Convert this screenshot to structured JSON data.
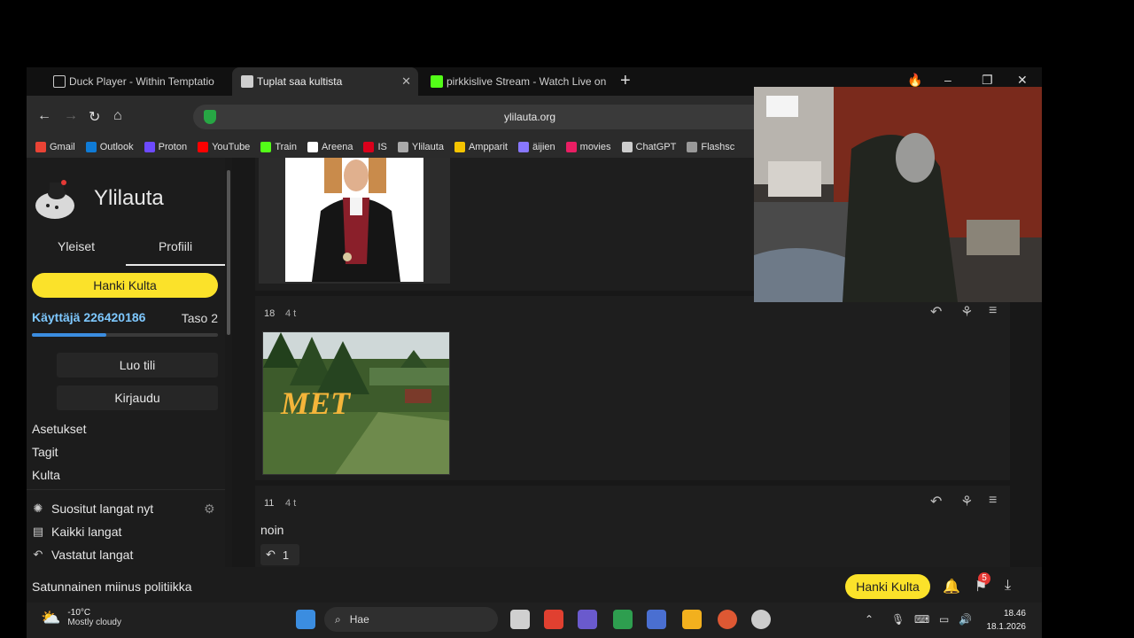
{
  "browser": {
    "tabs": [
      {
        "label": "Duck Player - Within Temptatio",
        "icon": "duck-player-icon"
      },
      {
        "label": "Tuplat saa kultista",
        "icon": "ylilauta-favicon",
        "active": true
      },
      {
        "label": "pirkkislive Stream - Watch Live on",
        "icon": "kick-favicon"
      }
    ],
    "new_tab": "+",
    "window_controls": {
      "minimize": "–",
      "restore": "❐",
      "close": "✕",
      "flame": "🔥"
    },
    "url": "ylilauta.org",
    "bookmarks": [
      {
        "label": "Gmail",
        "color": "#ea4335"
      },
      {
        "label": "Outlook",
        "color": "#0f7bd6"
      },
      {
        "label": "Proton",
        "color": "#6d4aff"
      },
      {
        "label": "YouTube",
        "color": "#ff0000"
      },
      {
        "label": "Train",
        "color": "#53fc18"
      },
      {
        "label": "Areena",
        "color": "#ffffff"
      },
      {
        "label": "IS",
        "color": "#d9001b"
      },
      {
        "label": "Ylilauta",
        "color": "#aaaaaa"
      },
      {
        "label": "Ampparit",
        "color": "#f5c400"
      },
      {
        "label": "äijien",
        "color": "#8877ff"
      },
      {
        "label": "movies",
        "color": "#e91e63"
      },
      {
        "label": "ChatGPT",
        "color": "#cccccc"
      },
      {
        "label": "Flashsc",
        "color": "#999999"
      }
    ]
  },
  "sidebar": {
    "brand": "Ylilauta",
    "tabs": [
      "Yleiset",
      "Profiili"
    ],
    "gold_button": "Hanki Kulta",
    "user": "Käyttäjä 226420186",
    "level": "Taso 2",
    "xp_fraction": 0.4,
    "create_account": "Luo tili",
    "login": "Kirjaudu",
    "links": [
      "Asetukset",
      "Tagit",
      "Kulta"
    ],
    "icon_links": [
      {
        "label": "Suositut langat nyt",
        "icon": "trending-icon"
      },
      {
        "label": "Kaikki langat",
        "icon": "threads-icon"
      },
      {
        "label": "Vastatut langat",
        "icon": "reply-icon"
      }
    ]
  },
  "posts": [
    {
      "num": "18",
      "age": "4 t",
      "image": "met-forest-image"
    },
    {
      "num": "11",
      "age": "4 t",
      "text": "noin",
      "replies": "1"
    }
  ],
  "bottombar": {
    "random_thread": "Satunnainen miinus politiikka",
    "gold_button": "Hanki Kulta",
    "notifications": "5"
  },
  "taskbar": {
    "temperature": "-10°C",
    "weather": "Mostly cloudy",
    "search_placeholder": "Hae",
    "time": "18.46",
    "date": "18.1.2026"
  },
  "colors": {
    "gold": "#fbe22a",
    "username": "#7ec8ff",
    "accent": "#3b8de0"
  }
}
